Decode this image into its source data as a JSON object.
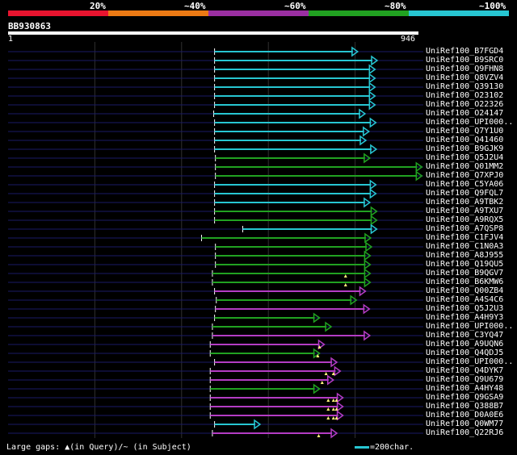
{
  "legend": {
    "items": [
      {
        "label": "20%",
        "color": "#e8142f"
      },
      {
        "label": "~40%",
        "color": "#ec7a14"
      },
      {
        "label": "~60%",
        "color": "#9b2fa2"
      },
      {
        "label": "~80%",
        "color": "#21a221"
      },
      {
        "label": "~100%",
        "color": "#27c6d2"
      }
    ]
  },
  "query": {
    "id": "BB930863",
    "start": "1",
    "end": "946",
    "length": 946
  },
  "colors": {
    "cyan": "#27c6d2",
    "green": "#21a221",
    "magenta": "#b43cc4",
    "purple": "#9b2fa2",
    "red": "#e8142f",
    "orange": "#ec7a14",
    "guide": "#1a1a66",
    "grid": "#303030",
    "marker": "#fff27a"
  },
  "hits": [
    {
      "name": "UniRef100_B7FGD4",
      "color": "cyan",
      "start": 476,
      "end": 806,
      "markers": []
    },
    {
      "name": "UniRef100_B9SRC0",
      "color": "cyan",
      "start": 476,
      "end": 851,
      "markers": []
    },
    {
      "name": "UniRef100_Q9FHN8",
      "color": "cyan",
      "start": 476,
      "end": 846,
      "markers": []
    },
    {
      "name": "UniRef100_Q8VZV4",
      "color": "cyan",
      "start": 476,
      "end": 846,
      "markers": []
    },
    {
      "name": "UniRef100_Q39130",
      "color": "cyan",
      "start": 476,
      "end": 846,
      "markers": []
    },
    {
      "name": "UniRef100_O23102",
      "color": "cyan",
      "start": 476,
      "end": 846,
      "markers": []
    },
    {
      "name": "UniRef100_O22326",
      "color": "cyan",
      "start": 476,
      "end": 846,
      "markers": []
    },
    {
      "name": "UniRef100_O24147",
      "color": "cyan",
      "start": 474,
      "end": 823,
      "markers": []
    },
    {
      "name": "UniRef100_UPI000..",
      "color": "cyan",
      "start": 476,
      "end": 848,
      "markers": []
    },
    {
      "name": "UniRef100_Q7Y1U0",
      "color": "cyan",
      "start": 476,
      "end": 832,
      "markers": []
    },
    {
      "name": "UniRef100_Q41460",
      "color": "cyan",
      "start": 476,
      "end": 825,
      "markers": []
    },
    {
      "name": "UniRef100_B9GJK9",
      "color": "cyan",
      "start": 476,
      "end": 849,
      "markers": []
    },
    {
      "name": "UniRef100_Q5J2U4",
      "color": "green",
      "start": 478,
      "end": 834,
      "markers": []
    },
    {
      "name": "UniRef100_Q01MM2",
      "color": "green",
      "start": 478,
      "end": 954,
      "markers": []
    },
    {
      "name": "UniRef100_Q7XPJ0",
      "color": "green",
      "start": 478,
      "end": 954,
      "markers": []
    },
    {
      "name": "UniRef100_C5YA06",
      "color": "cyan",
      "start": 476,
      "end": 848,
      "markers": []
    },
    {
      "name": "UniRef100_Q9FQL7",
      "color": "cyan",
      "start": 476,
      "end": 848,
      "markers": []
    },
    {
      "name": "UniRef100_A9TBK2",
      "color": "cyan",
      "start": 476,
      "end": 834,
      "markers": []
    },
    {
      "name": "UniRef100_A9TXU7",
      "color": "green",
      "start": 476,
      "end": 850,
      "markers": []
    },
    {
      "name": "UniRef100_A9RQX5",
      "color": "green",
      "start": 476,
      "end": 850,
      "markers": []
    },
    {
      "name": "UniRef100_A7QSP8",
      "color": "cyan",
      "start": 541,
      "end": 850,
      "markers": []
    },
    {
      "name": "UniRef100_C1FJV4",
      "color": "green",
      "start": 446,
      "end": 836,
      "markers": []
    },
    {
      "name": "UniRef100_C1N0A3",
      "color": "green",
      "start": 478,
      "end": 838,
      "markers": []
    },
    {
      "name": "UniRef100_A8J955",
      "color": "green",
      "start": 478,
      "end": 835,
      "markers": []
    },
    {
      "name": "UniRef100_Q19QU5",
      "color": "green",
      "start": 478,
      "end": 835,
      "markers": []
    },
    {
      "name": "UniRef100_B9QGV7",
      "color": "green",
      "start": 471,
      "end": 835,
      "markers": [
        778
      ]
    },
    {
      "name": "UniRef100_B6KMW6",
      "color": "green",
      "start": 471,
      "end": 835,
      "markers": [
        778
      ]
    },
    {
      "name": "UniRef100_Q00ZB4",
      "color": "magenta",
      "start": 476,
      "end": 824,
      "markers": []
    },
    {
      "name": "UniRef100_A4S4C6",
      "color": "green",
      "start": 480,
      "end": 803,
      "markers": []
    },
    {
      "name": "UniRef100_Q5J2U3",
      "color": "magenta",
      "start": 478,
      "end": 833,
      "markers": []
    },
    {
      "name": "UniRef100_A4H9Y3",
      "color": "green",
      "start": 476,
      "end": 718,
      "markers": []
    },
    {
      "name": "UniRef100_UPI000..",
      "color": "green",
      "start": 471,
      "end": 745,
      "markers": []
    },
    {
      "name": "UniRef100_C3YQ47",
      "color": "magenta",
      "start": 471,
      "end": 834,
      "markers": []
    },
    {
      "name": "UniRef100_A9UQN6",
      "color": "magenta",
      "start": 466,
      "end": 729,
      "markers": [
        718
      ]
    },
    {
      "name": "UniRef100_Q4QDJ5",
      "color": "green",
      "start": 466,
      "end": 718,
      "markers": [
        714
      ]
    },
    {
      "name": "UniRef100_UPI000..",
      "color": "magenta",
      "start": 476,
      "end": 758,
      "markers": []
    },
    {
      "name": "UniRef100_Q4DYK7",
      "color": "magenta",
      "start": 466,
      "end": 766,
      "markers": [
        733,
        750
      ]
    },
    {
      "name": "UniRef100_Q9U679",
      "color": "magenta",
      "start": 466,
      "end": 750,
      "markers": [
        724
      ]
    },
    {
      "name": "UniRef100_A4HY48",
      "color": "green",
      "start": 466,
      "end": 718,
      "markers": []
    },
    {
      "name": "UniRef100_Q9GSA9",
      "color": "magenta",
      "start": 466,
      "end": 772,
      "markers": [
        738,
        750,
        757
      ]
    },
    {
      "name": "UniRef100_Q388B7",
      "color": "magenta",
      "start": 466,
      "end": 772,
      "markers": [
        738,
        750,
        757
      ]
    },
    {
      "name": "UniRef100_D0A0E6",
      "color": "magenta",
      "start": 466,
      "end": 772,
      "markers": [
        738,
        750,
        757
      ]
    },
    {
      "name": "UniRef100_Q0WM77",
      "color": "cyan",
      "start": 476,
      "end": 581,
      "markers": []
    },
    {
      "name": "UniRef100_Q22RJ6",
      "color": "magenta",
      "start": 471,
      "end": 758,
      "markers": [
        716
      ]
    }
  ],
  "footer": {
    "gap_note": "Large gaps: ▲(in Query)/~ (in Subject)",
    "scale_text": "=200char."
  }
}
